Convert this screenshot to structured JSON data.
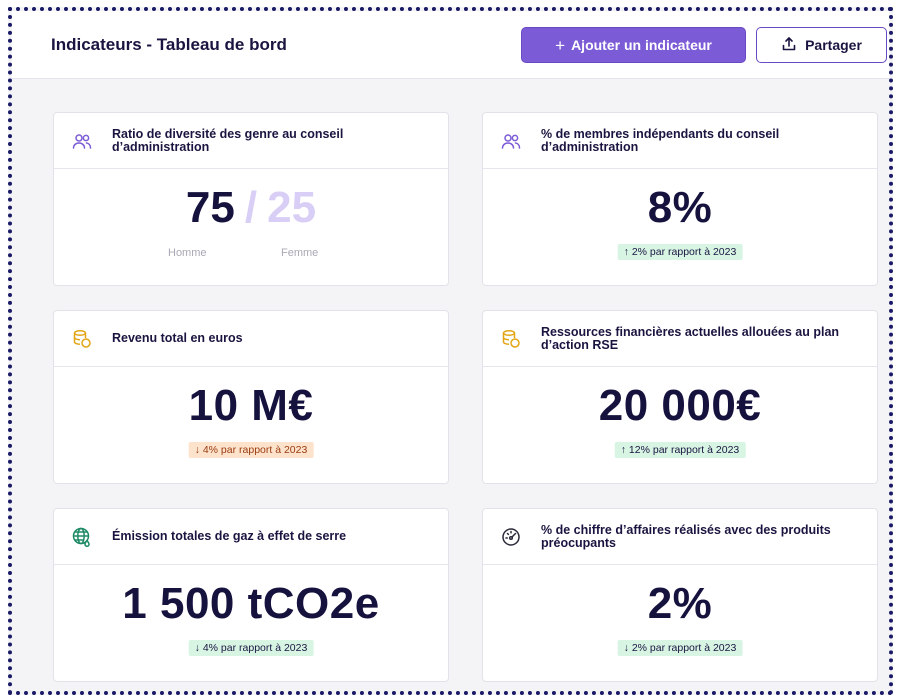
{
  "header": {
    "title": "Indicateurs - Tableau de bord",
    "add_button": "Ajouter un indicateur",
    "add_button_icon": "+",
    "share_button": "Partager"
  },
  "colors": {
    "accent": "#7b5bd6",
    "icon_purple": "#7b5bd6",
    "icon_yellow": "#e3a516",
    "icon_green": "#1e8a66",
    "badge_green": "#d8f5e4",
    "badge_orange": "#fde3cc"
  },
  "cards": [
    {
      "icon": "users-icon",
      "title": "Ratio de diversité des genre au conseil d’administration",
      "ratio_left": "75",
      "ratio_sep": "/",
      "ratio_right": "25",
      "label_left": "Homme",
      "label_right": "Femme"
    },
    {
      "icon": "users-icon",
      "title": "% de membres indépendants du conseil d’administration",
      "value": "8%",
      "badge": "↑ 2% par rapport à 2023"
    },
    {
      "icon": "coins-icon",
      "title": "Revenu total en euros",
      "value": "10 M€",
      "badge": "↓ 4% par rapport à 2023"
    },
    {
      "icon": "coins-icon",
      "title": "Ressources financières actuelles allouées au plan d’action RSE",
      "value": "20 000€",
      "badge": "↑ 12% par rapport à 2023"
    },
    {
      "icon": "globe-icon",
      "title": "Émission totales de gaz à effet de serre",
      "value": "1 500 tCO2e",
      "badge": "↓ 4% par rapport à 2023"
    },
    {
      "icon": "gauge-icon",
      "title": "% de chiffre d’affaires réalisés avec des produits préocupants",
      "value": "2%",
      "badge": "↓ 2% par rapport à 2023"
    }
  ]
}
